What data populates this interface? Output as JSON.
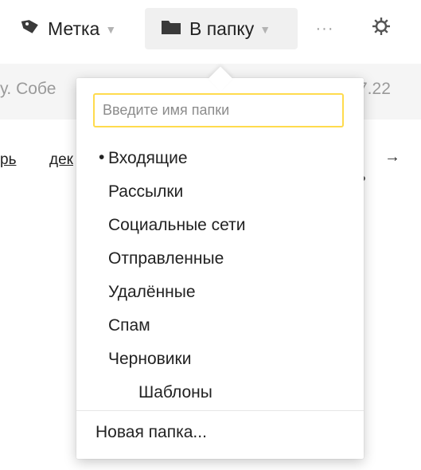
{
  "toolbar": {
    "label_button": {
      "label": "Метка",
      "icon": "tag-icon"
    },
    "folder_button": {
      "label": "В папку",
      "icon": "folder-icon"
    },
    "more_button": {
      "label": "···"
    },
    "settings_button": {
      "icon": "gear-icon"
    },
    "caret": "▼"
  },
  "background": {
    "subject_fragment": "у. Собе",
    "date_fragment": "7.22",
    "links": [
      "рь",
      "дек"
    ],
    "arrow": "→"
  },
  "folder_popup": {
    "search_placeholder": "Введите имя папки",
    "selected_bullet": "•",
    "folders": [
      {
        "name": "Входящие",
        "selected": true,
        "level": 0
      },
      {
        "name": "Рассылки",
        "selected": false,
        "level": 0
      },
      {
        "name": "Социальные сети",
        "selected": false,
        "level": 0
      },
      {
        "name": "Отправленные",
        "selected": false,
        "level": 0
      },
      {
        "name": "Удалённые",
        "selected": false,
        "level": 0
      },
      {
        "name": "Спам",
        "selected": false,
        "level": 0
      },
      {
        "name": "Черновики",
        "selected": false,
        "level": 0
      },
      {
        "name": "Шаблоны",
        "selected": false,
        "level": 1
      }
    ],
    "new_folder_label": "Новая папка..."
  },
  "colors": {
    "search_border": "#ffdb4d",
    "folder_button_bg": "#f0f0f0",
    "muted_text": "#9a9a9a"
  }
}
